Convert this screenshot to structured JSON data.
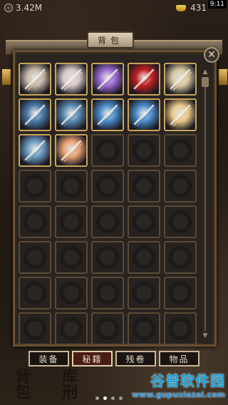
{
  "status_bar": {
    "coins": "3.42M",
    "gold": "431",
    "time": "9:11",
    "coin_icon": "coin-icon",
    "gold_icon": "gold-ingot-icon"
  },
  "panel": {
    "title": "背包"
  },
  "inventory": {
    "total_visible_slots": 40,
    "items": [
      {
        "icon": "fist-skill-icon",
        "color": "#c8b8a8"
      },
      {
        "icon": "punch-skill-icon",
        "color": "#d8c8c8"
      },
      {
        "icon": "purple-wave-skill-icon",
        "color": "#9a6ad0"
      },
      {
        "icon": "red-banner-skill-icon",
        "color": "#c02020"
      },
      {
        "icon": "crossed-blades-skill-icon",
        "color": "#d8c8a0"
      },
      {
        "icon": "sword-slash-skill-icon",
        "color": "#4a7aa8"
      },
      {
        "icon": "sword-strike-skill-icon",
        "color": "#5a8ab0"
      },
      {
        "icon": "blue-figure-skill-icon",
        "color": "#4a8ac8"
      },
      {
        "icon": "blue-kick-skill-icon",
        "color": "#4a8ac8"
      },
      {
        "icon": "light-sword-skill-icon",
        "color": "#e8c888"
      },
      {
        "icon": "blade-flash-skill-icon",
        "color": "#6a9ac0"
      },
      {
        "icon": "double-blade-skill-icon",
        "color": "#e8a070"
      }
    ]
  },
  "tabs": [
    {
      "label": "装备"
    },
    {
      "label": "秘籍"
    },
    {
      "label": "残卷"
    },
    {
      "label": "物品"
    }
  ],
  "background_text": {
    "left": "背包",
    "middle": "库刑"
  },
  "watermark": {
    "title": "谷普软件园",
    "url": "www.gupuxiazai.com"
  }
}
